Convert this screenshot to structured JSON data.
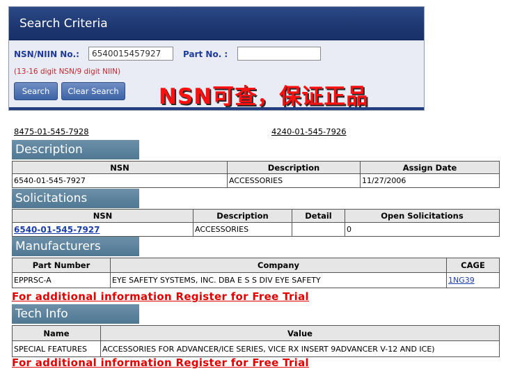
{
  "search": {
    "title": "Search Criteria",
    "nsn_label": "NSN/NIIN No.",
    "nsn_value": "6540015457927",
    "part_label": "Part No.",
    "part_value": "",
    "hint": "(13-16 digit NSN/9 digit NIIN)",
    "search_button": "Search",
    "clear_button": "Clear Search"
  },
  "promo_text": "NSN可查，保证正品",
  "nav": {
    "prev": "8475-01-545-7928",
    "next": "4240-01-545-7926"
  },
  "description": {
    "heading": "Description",
    "columns": [
      "NSN",
      "Description",
      "Assign Date"
    ],
    "rows": [
      [
        "6540-01-545-7927",
        "ACCESSORIES",
        "11/27/2006"
      ]
    ]
  },
  "solicitations": {
    "heading": "Solicitations",
    "columns": [
      "NSN",
      "Description",
      "Detail",
      "Open Solicitations"
    ],
    "rows": [
      [
        "6540-01-545-7927",
        "ACCESSORIES",
        "",
        "0"
      ]
    ]
  },
  "manufacturers": {
    "heading": "Manufacturers",
    "columns": [
      "Part Number",
      "Company",
      "CAGE"
    ],
    "rows": [
      [
        "EPPRSC-A",
        "EYE SAFETY SYSTEMS, INC. DBA E S S DIV EYE SAFETY",
        "1NG39"
      ]
    ]
  },
  "register_text": "For additional information Register for Free Trial",
  "tech": {
    "heading": "Tech Info",
    "columns": [
      "Name",
      "Value"
    ],
    "rows": [
      [
        "SPECIAL FEATURES",
        "ACCESSORIES FOR ADVANCER/ICE SERIES, VICE RX INSERT 9ADVANCER V-12 AND ICE)"
      ]
    ]
  },
  "colors": {
    "header_blue": "#1e3771",
    "section_teal": "#5b829c",
    "promo_red": "#ff1010",
    "link_blue": "#1a3ea8"
  }
}
